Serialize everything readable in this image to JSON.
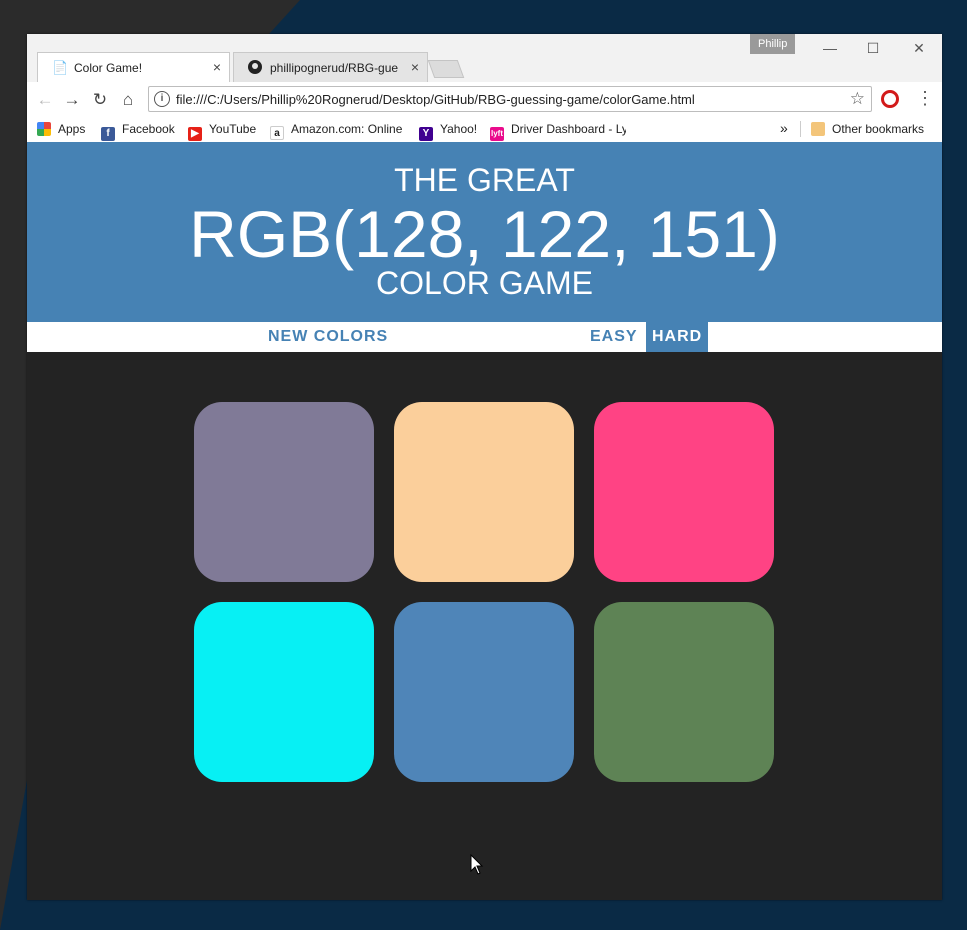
{
  "browser": {
    "user_badge": "Phillip",
    "window_controls": {
      "minimize": "—",
      "maximize": "☐",
      "close": "✕"
    },
    "tabs": [
      {
        "title": "Color Game!",
        "icon": "page-icon",
        "active": true
      },
      {
        "title": "phillipognerud/RBG-gue",
        "icon": "github-icon",
        "active": false
      }
    ],
    "tab_close": "×",
    "url": "file:///C:/Users/Phillip%20Rognerud/Desktop/GitHub/RBG-guessing-game/colorGame.html",
    "nav_icons": {
      "back": "←",
      "forward": "→",
      "reload": "↻",
      "home": "⌂",
      "star": "☆",
      "menu": "⋮"
    },
    "bookmarks": [
      {
        "label": "Apps",
        "icon": "apps-icon",
        "color": "#e8453c"
      },
      {
        "label": "Facebook",
        "icon": "facebook-icon",
        "color": "#3b5998"
      },
      {
        "label": "YouTube",
        "icon": "youtube-icon",
        "color": "#e62117"
      },
      {
        "label": "Amazon.com: Online",
        "icon": "amazon-icon",
        "color": "#232f3e"
      },
      {
        "label": "Yahoo!",
        "icon": "yahoo-icon",
        "color": "#400090"
      },
      {
        "label": "Driver Dashboard - Ly",
        "icon": "lyft-icon",
        "color": "#ea0b8c"
      }
    ],
    "bookmarks_overflow": "»",
    "other_bookmarks": "Other bookmarks"
  },
  "game": {
    "header_line1": "THE GREAT",
    "target_color": "RGB(128, 122, 151)",
    "header_line3": "COLOR GAME",
    "header_color": "#4682b4",
    "new_colors_label": "NEW COLORS",
    "easy_label": "EASY",
    "hard_label": "HARD",
    "selected_mode": "HARD",
    "squares": [
      {
        "color": "#807a97"
      },
      {
        "color": "#fbcf9b"
      },
      {
        "color": "#ff4384"
      },
      {
        "color": "#07f0f4"
      },
      {
        "color": "#4f85b8"
      },
      {
        "color": "#5e8355"
      }
    ]
  }
}
